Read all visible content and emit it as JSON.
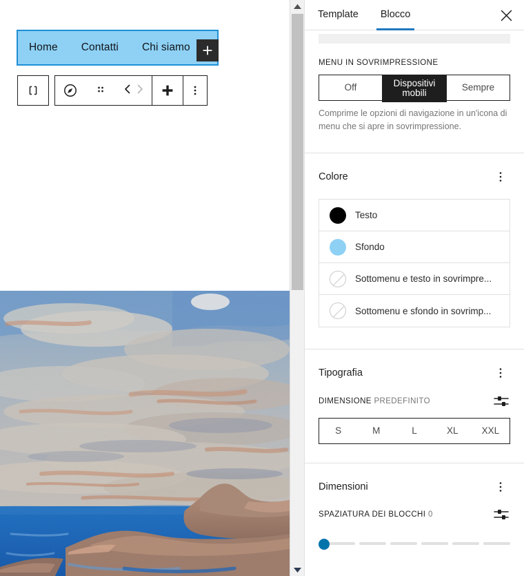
{
  "canvas": {
    "nav_block": {
      "items": [
        {
          "label": "Home"
        },
        {
          "label": "Contatti"
        },
        {
          "label": "Chi siamo"
        }
      ],
      "background_color": "#8ed1f5",
      "selected_border_color": "#1f8fd6",
      "appender_label": "+"
    },
    "toolbar": {
      "block_type_label": "Navigazione",
      "buttons": [
        {
          "name": "block-type-icon",
          "label": "Navigazione"
        },
        {
          "name": "justify-items-icon",
          "label": "Giustifica elementi"
        },
        {
          "name": "drag-handle-icon",
          "label": "Trascina"
        },
        {
          "name": "move-up-icon",
          "label": "Sposta in alto"
        },
        {
          "name": "move-down-icon",
          "label": "Sposta in basso"
        },
        {
          "name": "add-block-icon",
          "label": "Aggiungi blocco"
        },
        {
          "name": "more-options-icon",
          "label": "Altre opzioni"
        }
      ]
    },
    "image": {
      "alt": "Dipinto a olio di un paesaggio marino con cielo nuvoloso, mare blu e promontori rocciosi"
    }
  },
  "scrollbar": {
    "up_arrow": "▲",
    "down_arrow": "▼",
    "thumb_position_pct": 2
  },
  "sidebar": {
    "tabs": [
      {
        "label": "Template",
        "active": false
      },
      {
        "label": "Blocco",
        "active": true
      }
    ],
    "close_label": "✕",
    "overlay_menu": {
      "label": "Menu in sovrimpressione",
      "options": [
        "Off",
        "Dispositivi mobili",
        "Sempre"
      ],
      "selected": "Dispositivi mobili",
      "help": "Comprime le opzioni di navigazione in un'icona di menu che si apre in sovrimpressione."
    },
    "color_panel": {
      "title": "Colore",
      "kebab_label": "Opzioni colore",
      "rows": [
        {
          "label": "Testo",
          "swatch": "#000000",
          "empty": false
        },
        {
          "label": "Sfondo",
          "swatch": "#8ed1f5",
          "empty": false
        },
        {
          "label": "Sottomenu e testo in sovrimpre...",
          "swatch": "",
          "empty": true
        },
        {
          "label": "Sottomenu e sfondo in sovrimp...",
          "swatch": "",
          "empty": true
        }
      ]
    },
    "typography_panel": {
      "title": "Tipografia",
      "kebab_label": "Opzioni tipografia",
      "size_label": "Dimensione",
      "size_value": "Predefinito",
      "tune_label": "Imposta dimensione personalizzata",
      "sizes": [
        "S",
        "M",
        "L",
        "XL",
        "XXL"
      ],
      "selected_size": ""
    },
    "dimensions_panel": {
      "title": "Dimensioni",
      "kebab_label": "Opzioni dimensioni",
      "block_spacing_label": "Spaziatura dei blocchi",
      "block_spacing_value": "0",
      "tune_label": "Imposta spaziatura personalizzata",
      "slider_segments": 6,
      "slider_value": 0
    }
  }
}
